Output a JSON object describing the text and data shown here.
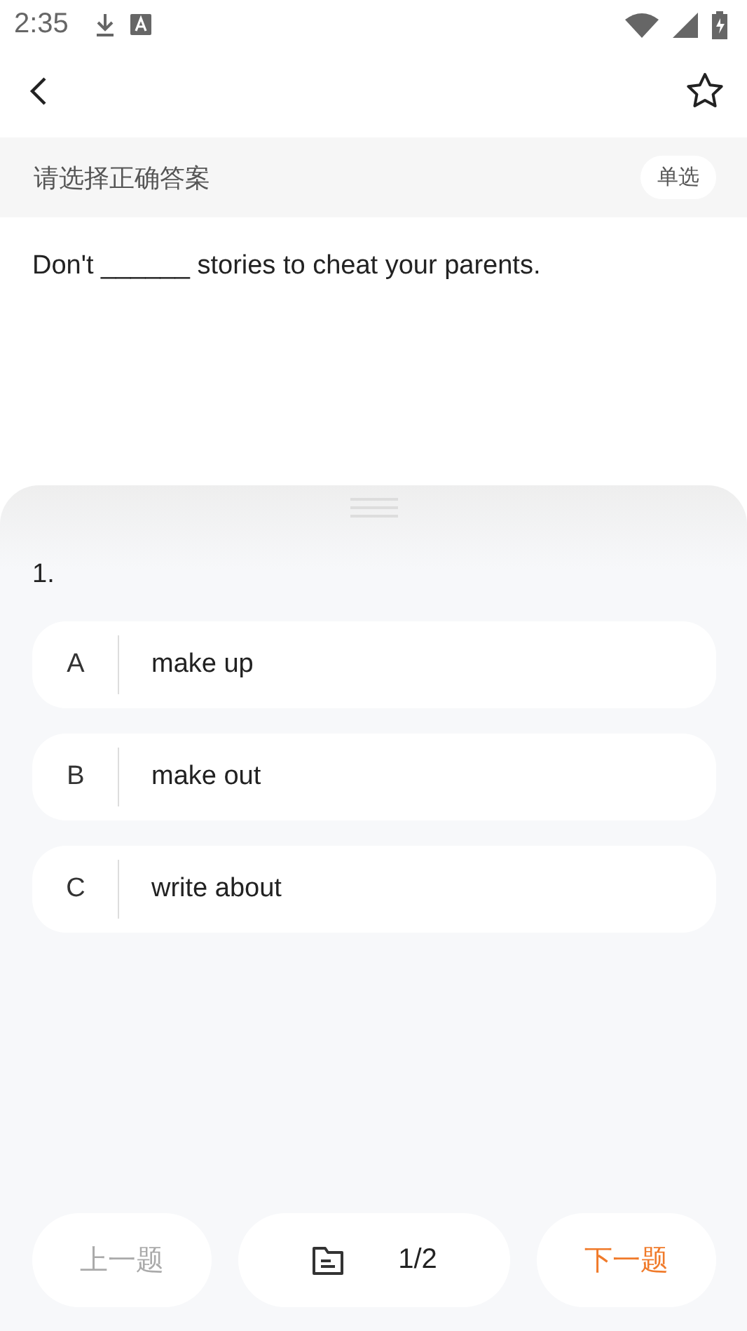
{
  "status_bar": {
    "time": "2:35"
  },
  "header": {
    "favorited": false
  },
  "instruction": {
    "text": "请选择正确答案",
    "type_badge": "单选"
  },
  "question": {
    "text": "Don't ______ stories to cheat your parents."
  },
  "answer_sheet": {
    "number": "1.",
    "options": [
      {
        "letter": "A",
        "text": "make up",
        "selected": false
      },
      {
        "letter": "B",
        "text": "make out",
        "selected": false
      },
      {
        "letter": "C",
        "text": "write about",
        "selected": false
      }
    ]
  },
  "footer": {
    "previous": {
      "label": "上一题",
      "disabled": true
    },
    "progress": "1/2",
    "next": {
      "label": "下一题",
      "disabled": false
    }
  }
}
